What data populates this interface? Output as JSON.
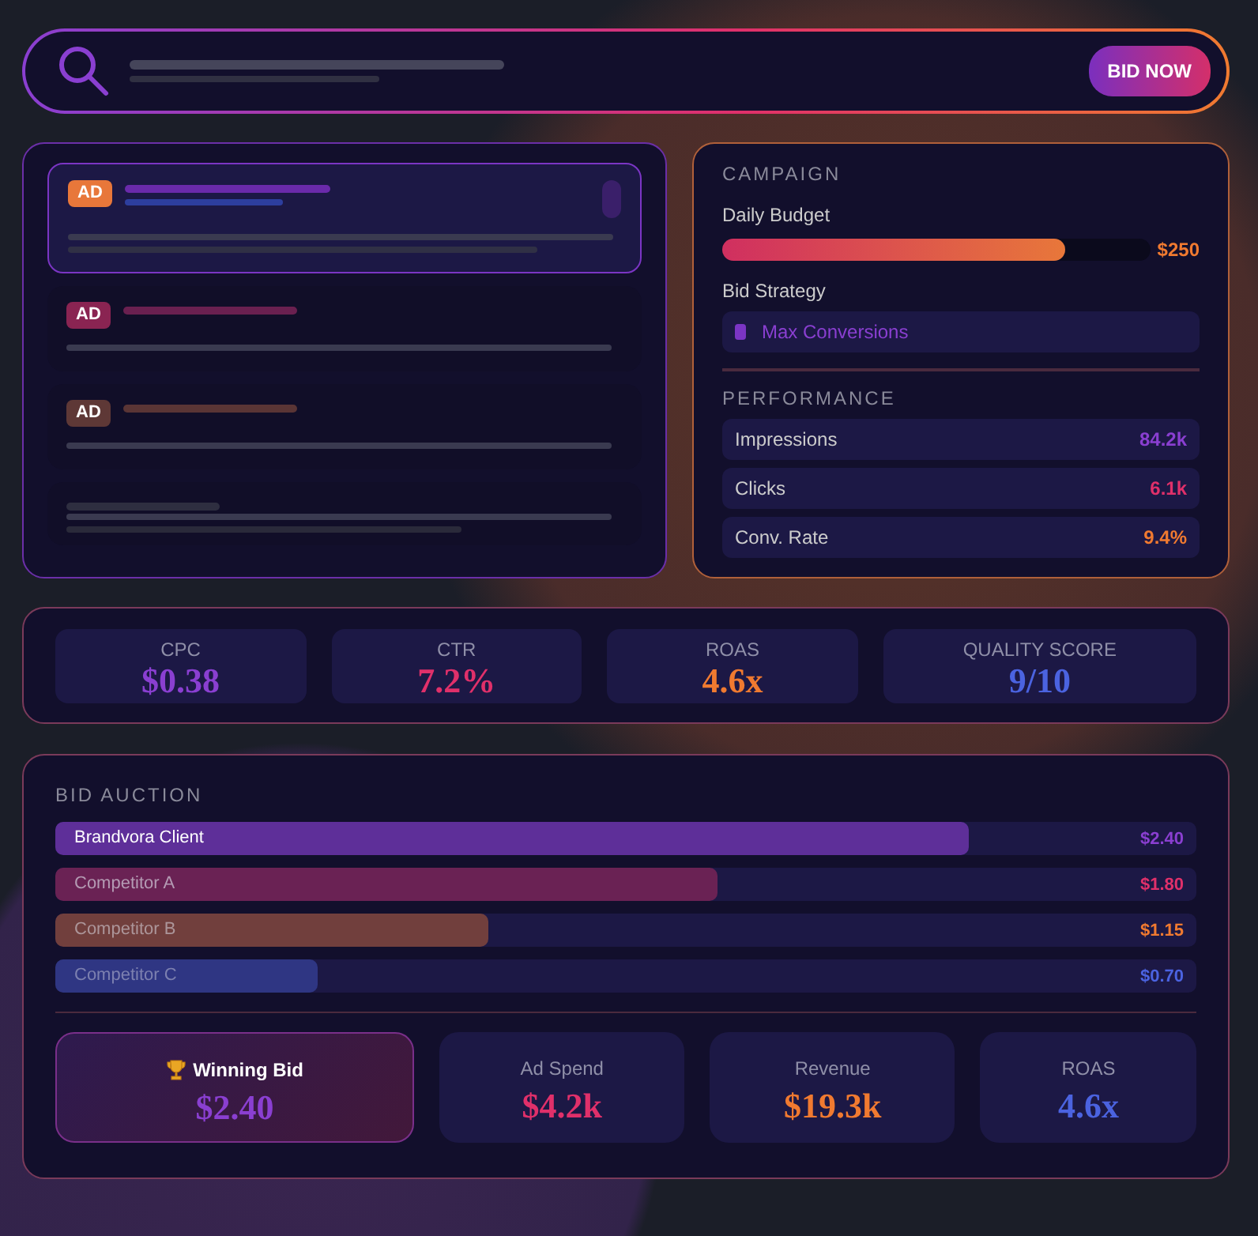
{
  "search": {
    "button": "BID NOW"
  },
  "ads": [
    {
      "badge": "AD",
      "color": "#e8773a",
      "selected": true
    },
    {
      "badge": "AD",
      "color": "#8a2452",
      "selected": false
    },
    {
      "badge": "AD",
      "color": "#5e3836",
      "selected": false
    },
    {
      "selected": false
    }
  ],
  "campaign": {
    "title": "CAMPAIGN",
    "budget_label": "Daily Budget",
    "level": 0.8,
    "budget_value": "$250",
    "strategy_label": "Bid Strategy",
    "strategy": "Max Conversions"
  },
  "performance": {
    "title": "PERFORMANCE",
    "rows": [
      {
        "label": "Impressions",
        "value": "84.2k",
        "color": "#8a3fd1"
      },
      {
        "label": "Clicks",
        "value": "6.1k",
        "color": "#e0306a"
      },
      {
        "label": "Conv. Rate",
        "value": "9.4%",
        "color": "#f07a30"
      }
    ]
  },
  "metrics": [
    {
      "label": "CPC",
      "value": "$0.38",
      "color": "#8a3fd1"
    },
    {
      "label": "CTR",
      "value": "7.2%",
      "color": "#e0306a"
    },
    {
      "label": "ROAS",
      "value": "4.6x",
      "color": "#f07a30"
    },
    {
      "label": "QUALITY SCORE",
      "value": "9/10",
      "color": "#4b63e0"
    }
  ],
  "auction": {
    "title": "BID AUCTION",
    "bids": [
      {
        "name": "Brandvora Client",
        "value": "$2.40",
        "level": 0.8,
        "color": "#8a3fd1"
      },
      {
        "name": "Competitor A",
        "value": "$1.80",
        "level": 0.58,
        "color": "#e0306a"
      },
      {
        "name": "Competitor B",
        "value": "$1.15",
        "level": 0.38,
        "color": "#f07a30"
      },
      {
        "name": "Competitor C",
        "value": "$0.70",
        "level": 0.23,
        "color": "#4b63e0"
      }
    ],
    "summary": [
      {
        "kind": "highlight",
        "label": "Winning Bid",
        "value": "$2.40",
        "color": "#8a3fd1"
      },
      {
        "kind": "plain",
        "label": "Ad Spend",
        "value": "$4.2k",
        "color": "#e0306a"
      },
      {
        "kind": "plain",
        "label": "Revenue",
        "value": "$19.3k",
        "color": "#f07a30"
      },
      {
        "kind": "plain",
        "label": "ROAS",
        "value": "4.6x",
        "color": "#4b63e0"
      }
    ]
  }
}
